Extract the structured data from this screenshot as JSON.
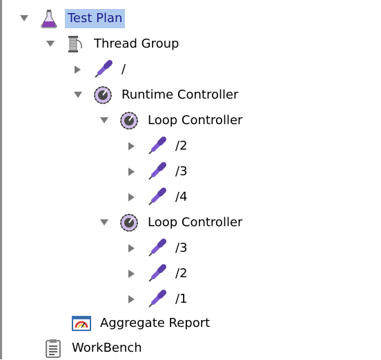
{
  "tree": {
    "nodes": [
      {
        "label": "Test Plan",
        "type": "test-plan",
        "expanded": true,
        "selected": true
      },
      {
        "label": "Thread Group",
        "type": "thread-group",
        "expanded": true
      },
      {
        "label": "/",
        "type": "sampler",
        "expanded": false
      },
      {
        "label": "Runtime Controller",
        "type": "controller",
        "expanded": true
      },
      {
        "label": "Loop Controller",
        "type": "controller",
        "expanded": true
      },
      {
        "label": "/2",
        "type": "sampler",
        "expanded": false
      },
      {
        "label": "/3",
        "type": "sampler",
        "expanded": false
      },
      {
        "label": "/4",
        "type": "sampler",
        "expanded": false
      },
      {
        "label": "Loop Controller",
        "type": "controller",
        "expanded": true
      },
      {
        "label": "/3",
        "type": "sampler",
        "expanded": false
      },
      {
        "label": "/2",
        "type": "sampler",
        "expanded": false
      },
      {
        "label": "/1",
        "type": "sampler",
        "expanded": false
      },
      {
        "label": "Aggregate Report",
        "type": "listener"
      },
      {
        "label": "WorkBench",
        "type": "workbench"
      }
    ]
  },
  "colors": {
    "selection": "#aecaf0",
    "selected_text": "#1a1a8a",
    "toggle": "#7a7a7a",
    "sampler_purple": "#7e5bd0"
  }
}
